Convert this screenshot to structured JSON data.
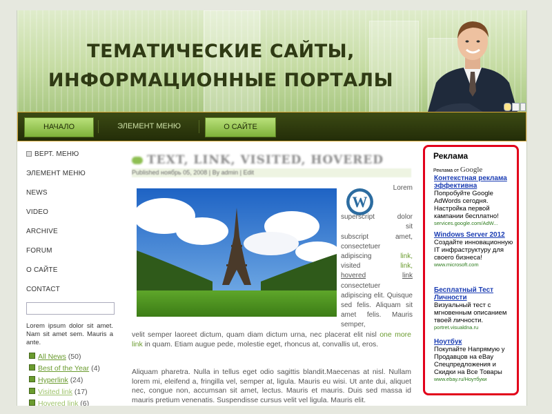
{
  "header": {
    "title_line1": "ТЕМАТИЧЕСКИЕ САЙТЫ,",
    "title_line2": "ИНФОРМАЦИОННЫЕ ПОРТАЛЫ"
  },
  "nav": {
    "items": [
      {
        "label": "НАЧАЛО",
        "active": true
      },
      {
        "label": "ЭЛЕМЕНТ МЕНЮ",
        "active": false
      },
      {
        "label": "О САЙТЕ",
        "active": true
      }
    ]
  },
  "sidebar": {
    "items": [
      "ВЕРТ. МЕНЮ",
      "ЭЛЕМЕНТ МЕНЮ",
      "NEWS",
      "VIDEO",
      "ARCHIVE",
      "FORUM",
      "О САЙТЕ",
      "CONTACT"
    ],
    "lorem": "Lorem ipsum dolor sit amet. Nam sit amet sem. Mauris a ante.",
    "categories": [
      {
        "label": "All News",
        "count": "(50)"
      },
      {
        "label": "Best of the Year",
        "count": "(4)"
      },
      {
        "label": "Hyperlink",
        "count": "(24)"
      },
      {
        "label": "Visited link",
        "count": "(17)"
      },
      {
        "label": "Hovered link",
        "count": "(6)"
      }
    ]
  },
  "post": {
    "title": "TEXT, LINK, VISITED, HOVERED",
    "meta": "Published ноябрь 05, 2008 | By admin | Edit",
    "right_col": {
      "lorem": "Lorem",
      "superscript": "superscript",
      "w1": "dolor",
      "w2": "sit",
      "subscript": "subscript",
      "amet": "amet,",
      "consectetuer": "consectetuer",
      "adipiscing": "adipiscing",
      "link": "link,",
      "visited": "visited",
      "link2": "link,",
      "hovered": "hovered",
      "link3": "link",
      "tail": "consectetuer adipiscing elit. Quisque sed felis. Aliquam sit amet felis. Mauris semper,"
    },
    "body1_a": "velit semper laoreet dictum, quam diam dictum urna, nec placerat elit nisl",
    "body1_link": "one more link",
    "body1_b": "in quam. Etiam augue pede, molestie eget, rhoncus at, convallis ut, eros.",
    "body2": "Aliquam pharetra. Nulla in tellus eget odio sagittis blandit.Maecenas at nisl. Nullam lorem mi, eleifend a, fringilla vel, semper at, ligula. Mauris eu wisi. Ut ante dui, aliquet nec, congue non, accumsan sit amet, lectus. Mauris et mauris. Duis sed massa id mauris pretium venenatis. Suspendisse cursus velit vel ligula. Mauris elit."
  },
  "ad": {
    "title": "Реклама",
    "by_prefix": "Реклама от",
    "by_brand": "Google",
    "blocks": [
      {
        "heading": "Контекстная реклама эффективна",
        "text": "Попробуйте Google AdWords сегодня. Настройка первой кампании бесплатно!",
        "url": "services.google.com/AdW..."
      },
      {
        "heading": "Windows Server 2012",
        "text": "Создайте инновационную IT инфраструктуру для своего бизнеса!",
        "url": "www.microsoft.com"
      },
      {
        "heading": "Бесплатный Тест Личности",
        "text": "Визуальный тест с мгновенным описанием твоей личности.",
        "url": "portret.visualdna.ru"
      },
      {
        "heading": "Ноутбук",
        "text": "Покупайте Напрямую у Продавцов на eBay Спецпредложения и Скидки на Все Товары",
        "url": "www.ebay.ru/Ноутбуки"
      }
    ]
  },
  "colors": {
    "nav_bg": "#2b3610",
    "nav_active": "#9acd55",
    "link_green": "#6a9b2e",
    "ad_border": "#e2001a",
    "ad_link": "#1a3cb3"
  }
}
